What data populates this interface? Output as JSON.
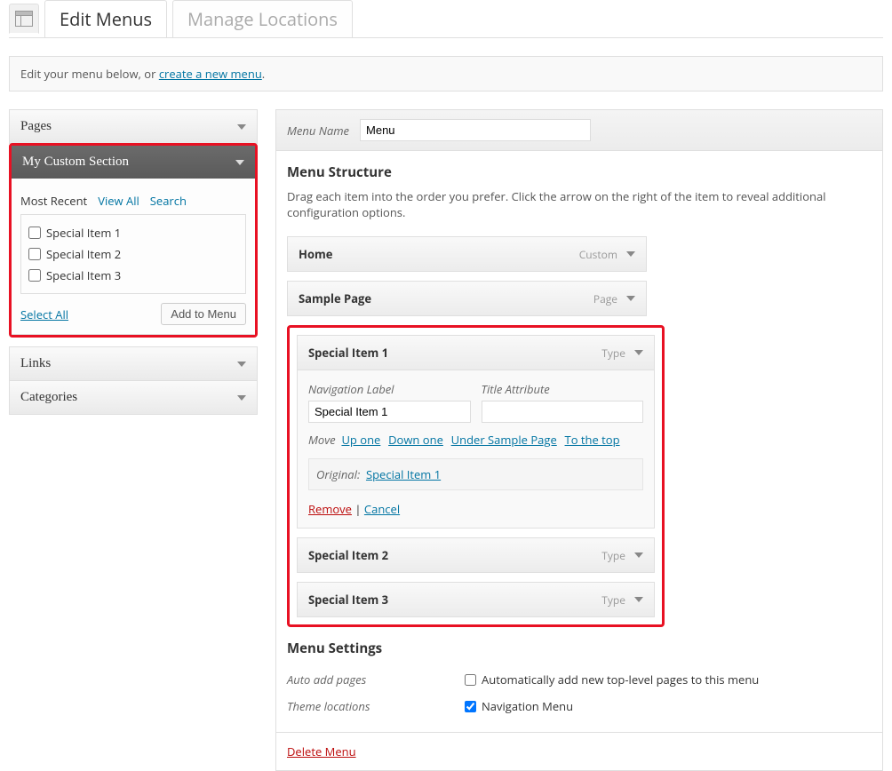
{
  "tabs": {
    "edit": "Edit Menus",
    "manage": "Manage Locations"
  },
  "notice": {
    "prefix": "Edit your menu below, or ",
    "link": "create a new menu",
    "suffix": "."
  },
  "sidebar": {
    "pages": "Pages",
    "custom": "My Custom Section",
    "links": "Links",
    "categories": "Categories",
    "subtabs": {
      "recent": "Most Recent",
      "viewall": "View All",
      "search": "Search"
    },
    "items": [
      "Special Item 1",
      "Special Item 2",
      "Special Item 3"
    ],
    "selectAll": "Select All",
    "addToMenu": "Add to Menu"
  },
  "main": {
    "menuNameLabel": "Menu Name",
    "menuNameValue": "Menu",
    "structureTitle": "Menu Structure",
    "structureDesc": "Drag each item into the order you prefer. Click the arrow on the right of the item to reveal additional configuration options.",
    "items": [
      {
        "title": "Home",
        "type": "Custom"
      },
      {
        "title": "Sample Page",
        "type": "Page"
      }
    ],
    "highlighted": [
      {
        "title": "Special Item 1",
        "type": "Type",
        "expanded": true,
        "navLabel": "Navigation Label",
        "navValue": "Special Item 1",
        "titleAttrLabel": "Title Attribute",
        "titleAttrValue": "",
        "moveLabel": "Move",
        "moveLinks": [
          "Up one",
          "Down one",
          "Under Sample Page",
          "To the top"
        ],
        "originalLabel": "Original:",
        "originalLink": "Special Item 1",
        "remove": "Remove",
        "cancel": "Cancel"
      },
      {
        "title": "Special Item 2",
        "type": "Type"
      },
      {
        "title": "Special Item 3",
        "type": "Type"
      }
    ],
    "settings": {
      "title": "Menu Settings",
      "autoAddLabel": "Auto add pages",
      "autoAddText": "Automatically add new top-level pages to this menu",
      "themeLabel": "Theme locations",
      "themeText": "Navigation Menu"
    },
    "deleteMenu": "Delete Menu"
  }
}
